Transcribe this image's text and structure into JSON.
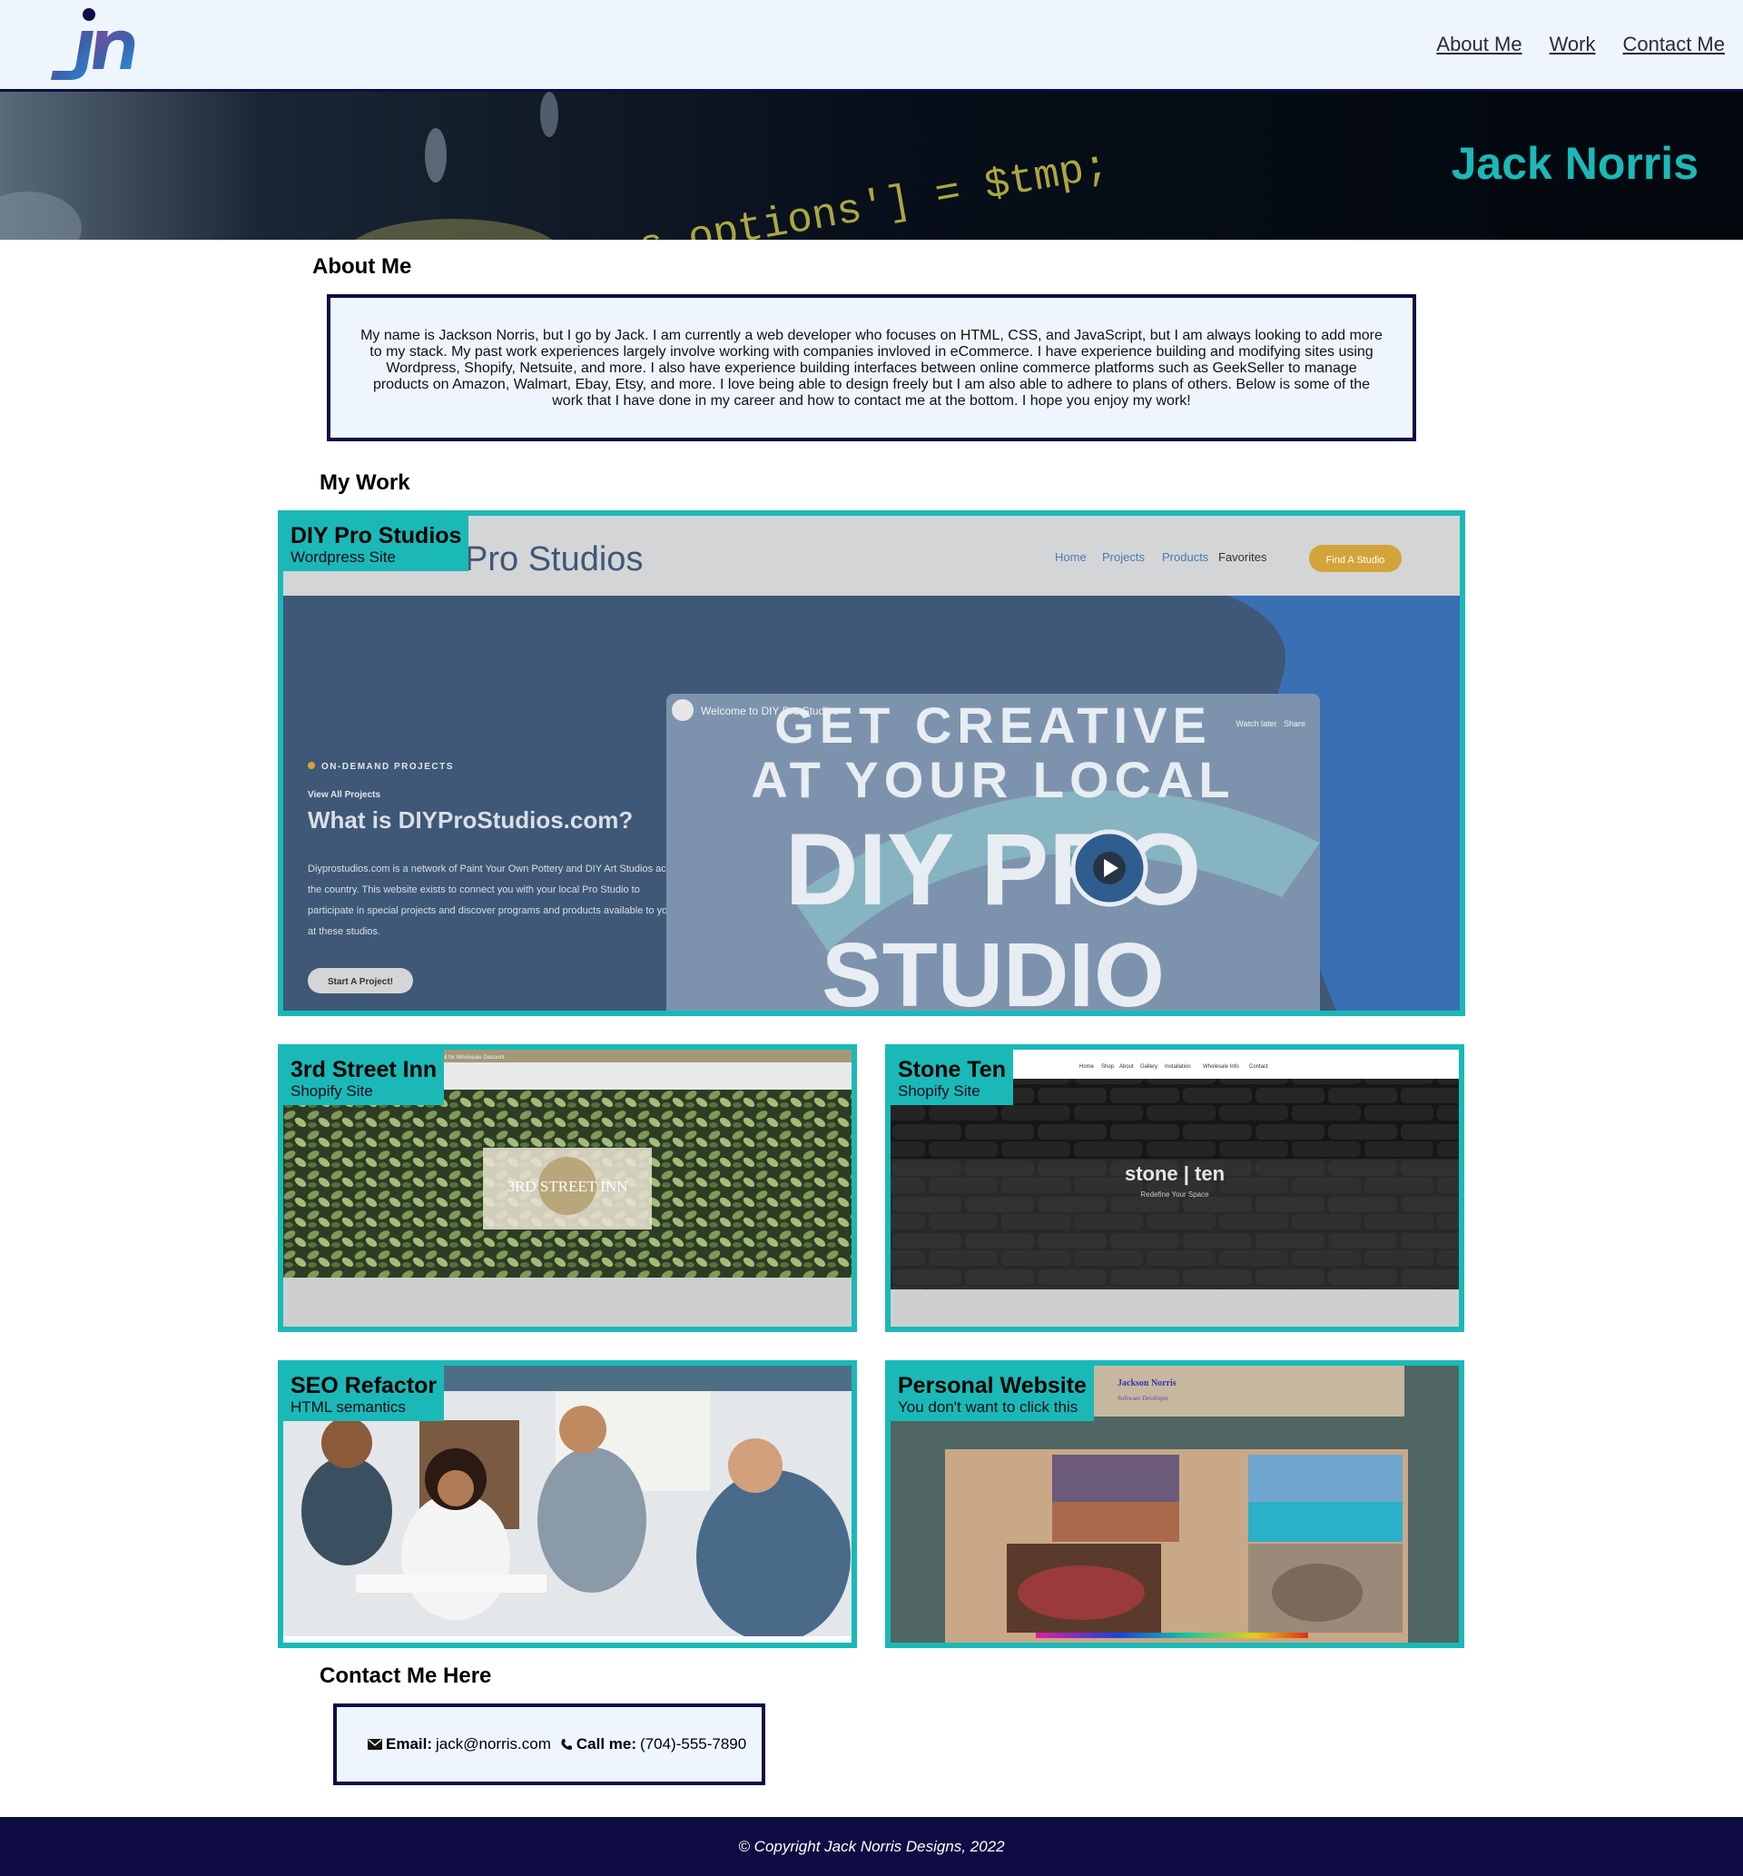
{
  "brand": {
    "logo_text": "jn"
  },
  "nav": {
    "links": [
      "About Me",
      "Work",
      "Contact Me"
    ]
  },
  "hero": {
    "title": "Jack Norris",
    "code_text": "s.options'] = $tmp;"
  },
  "about": {
    "heading": "About Me",
    "text": "My name is Jackson Norris, but I go by Jack. I am currently a web developer who focuses on HTML, CSS, and JavaScript, but I am always looking to add more to my stack. My past work experiences largely involve working with companies invloved in eCommerce. I have experience building and modifying sites using Wordpress, Shopify, Netsuite, and more. I also have experience building interfaces between online commerce platforms such as GeekSeller to manage products on Amazon, Walmart, Ebay, Etsy, and more. I love being able to design freely but I am also able to adhere to plans of others. Below is some of the work that I have done in my career and how to contact me at the bottom. I hope you enjoy my work!"
  },
  "work": {
    "heading": "My Work",
    "projects": [
      {
        "title": "DIY Pro Studios",
        "subtitle": "Wordpress Site"
      },
      {
        "title": "3rd Street Inn",
        "subtitle": "Shopify Site"
      },
      {
        "title": "Stone Ten",
        "subtitle": "Shopify Site"
      },
      {
        "title": "SEO Refactor",
        "subtitle": "HTML semantics"
      },
      {
        "title": "Personal Website",
        "subtitle": "You don't want to click this"
      }
    ],
    "diy_shot": {
      "brand": "Pro Studios",
      "menu": [
        "Home",
        "Projects",
        "Products",
        "Favorites"
      ],
      "cta": "Find A Studio",
      "tag": "ON-DEMAND PROJECTS",
      "link": "View All Projects",
      "heading": "What is DIYProStudios.com?",
      "body": [
        "Diyprostudios.com is a network of Paint Your Own Pottery and DIY Art Studios across",
        "the country. This website exists to connect you with your local Pro Studio to",
        "participate in special projects and discover programs and products available to you",
        "at these studios."
      ],
      "button": "Start A Project!",
      "video_title": "Welcome to DIY Pro Studios",
      "video_actions": [
        "Watch later",
        "Share"
      ],
      "video_lines": [
        "GET CREATIVE",
        "AT YOUR LOCAL",
        "DIY PRO",
        "STUDIO"
      ]
    },
    "inn_shot": {
      "logo": "3RD STREET INN",
      "banner": "Call for Wholesale Discount"
    },
    "stone_shot": {
      "logo": "stone | ten",
      "tagline": "Redefine Your Space",
      "menu": [
        "Home",
        "Shop",
        "About",
        "Gallery",
        "Installation",
        "Wholesale Info",
        "Contact"
      ]
    },
    "personal_shot": {
      "name": "Jackson Norris",
      "role": "Software Developer"
    }
  },
  "contact": {
    "heading": "Contact Me Here",
    "email_label": "Email:",
    "email": "jack@norris.com",
    "phone_label": "Call me:",
    "phone": "(704)-555-7890",
    "icons": [
      "envelope-icon",
      "phone-icon"
    ]
  },
  "footer": {
    "text": "© Copyright Jack Norris Designs, 2022"
  },
  "colors": {
    "accent": "#1ab9b7",
    "navy": "#0f0c44",
    "nav_bg": "#eef5fd"
  }
}
